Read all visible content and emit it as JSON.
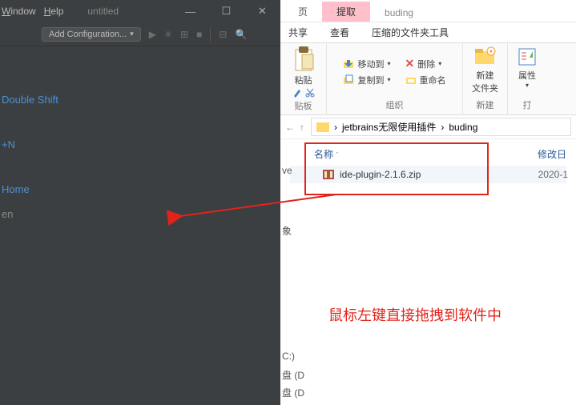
{
  "ide": {
    "menu": {
      "window": "Window",
      "help": "Help",
      "title": "untitled"
    },
    "toolbar": {
      "add_config": "Add Configuration..."
    },
    "shortcuts": {
      "line1": "Double Shift",
      "line2": "+N",
      "line3": "Home",
      "line4": "en"
    },
    "sidepanel": {
      "drive_e": "ve",
      "pictures": "象",
      "c": "C:)",
      "d1": "盘 (D",
      "d2": "盘 (D"
    }
  },
  "explorer": {
    "tabs": {
      "main": "页",
      "pink": "提取",
      "inactive": "buding"
    },
    "cmdtabs": {
      "share": "共享",
      "view": "查看",
      "archive": "压缩的文件夹工具"
    },
    "ribbon": {
      "paste": "粘贴",
      "paste_group": "贴板",
      "moveto": "移动到",
      "delete": "删除",
      "copyto": "复制到",
      "rename": "重命名",
      "org_group": "组织",
      "newfolder": "新建\n文件夹",
      "new_group": "新建",
      "props": "属性",
      "open_group": "打"
    },
    "addr": {
      "crumb1": "jetbrains无限使用插件",
      "crumb2": "buding",
      "sep": "›"
    },
    "columns": {
      "name": "名称",
      "date": "修改日"
    },
    "file": {
      "name": "ide-plugin-2.1.6.zip",
      "date": "2020-1"
    }
  },
  "annotation": "鼠标左键直接拖拽到软件中"
}
